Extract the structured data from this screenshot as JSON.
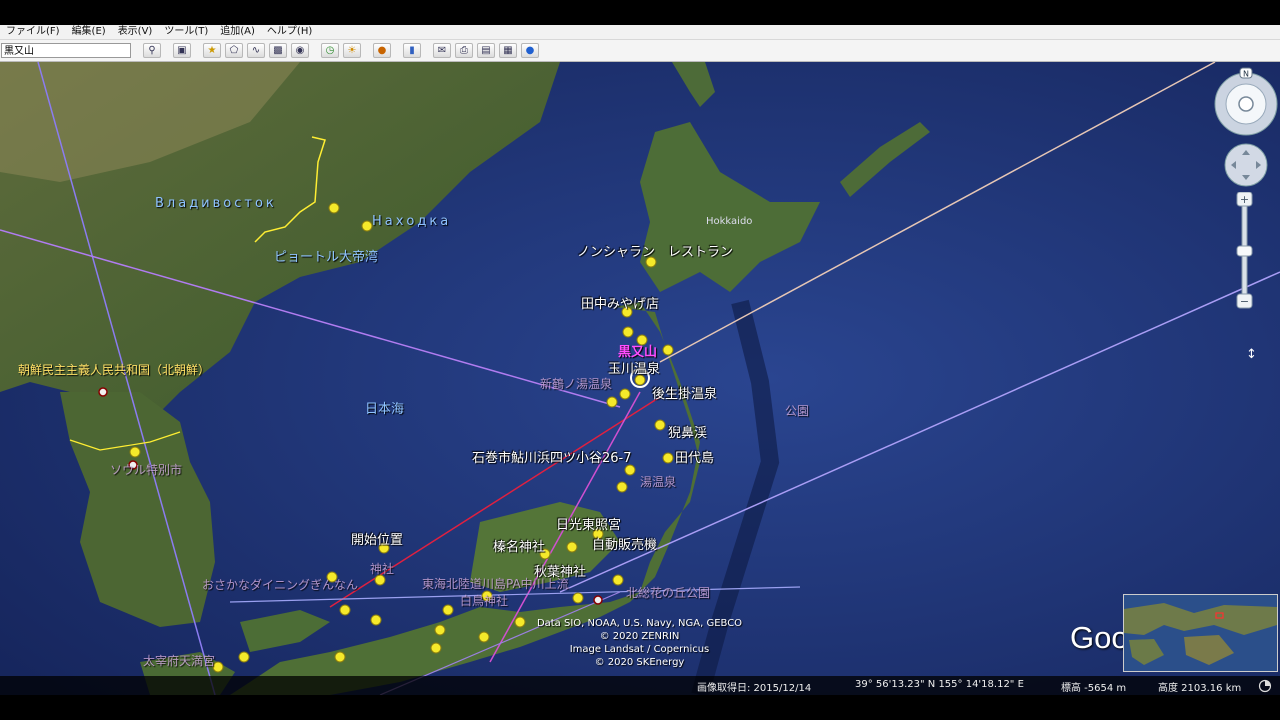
{
  "menu": [
    "ファイル(F)",
    "編集(E)",
    "表示(V)",
    "ツール(T)",
    "追加(A)",
    "ヘルプ(H)"
  ],
  "search": {
    "value": "黒又山"
  },
  "toolbar": {
    "icons": [
      "search-icon",
      "sidebar-toggle-icon",
      "add-placemark-icon",
      "add-polygon-icon",
      "add-path-icon",
      "add-image-overlay-icon",
      "record-tour-icon",
      "historical-imagery-icon",
      "sun-icon",
      "planets-icon",
      "ruler-icon",
      "email-icon",
      "print-icon",
      "save-image-icon",
      "view-in-maps-icon",
      "earth-gallery-icon"
    ]
  },
  "map": {
    "labels": {
      "vladivostok": "Владивосток",
      "nakhodka": "Находка",
      "peter_bay": "ピョートル大帝湾",
      "north_korea": "朝鮮民主主義人民共和国（北朝鮮）",
      "seoul": "ソウル特別市",
      "sea_of_japan": "日本海",
      "hokkaido": "Hokkaido",
      "nonsharan": "ノンシャラン　レストラン",
      "tanaka": "田中みやげ店",
      "kuromatayama": "黒又山",
      "tamagawa": "玉川温泉",
      "goshougake": "後生掛温泉",
      "geibikei": "猊鼻渓",
      "ishinomaki": "石巻市鮎川浜四ツ小谷26-7",
      "tashirojima": "田代島",
      "onsen": "湯温泉",
      "nikko": "日光東照宮",
      "jihanki": "自動販売機",
      "haruna": "榛名神社",
      "akiba": "秋葉神社",
      "start": "開始位置",
      "shrine": "神社",
      "osakana": "おさかなダイニングぎんなん",
      "tokai": "東海北陸道川島PA中川上流",
      "hakusan": "白鳥神社",
      "sosuke": "北総花の丘公園",
      "dazaifu": "太宰府天満宮",
      "shinyotamagawa": "新鶴ノ湯温泉",
      "kouen": "公園"
    },
    "attribution": [
      "Data SIO, NOAA, U.S. Navy, NGA, GEBCO",
      "© 2020 ZENRIN",
      "Image Landsat / Copernicus",
      "© 2020 SKEnergy"
    ],
    "logo": "Google Earth",
    "compass_letter": "N"
  },
  "status": {
    "imagery_date": "画像取得日: 2015/12/14",
    "coords": "39° 56'13.23\" N  155° 14'18.12\" E",
    "elevation": "標高 -5654 m",
    "eye_alt": "高度 2103.16 km"
  }
}
